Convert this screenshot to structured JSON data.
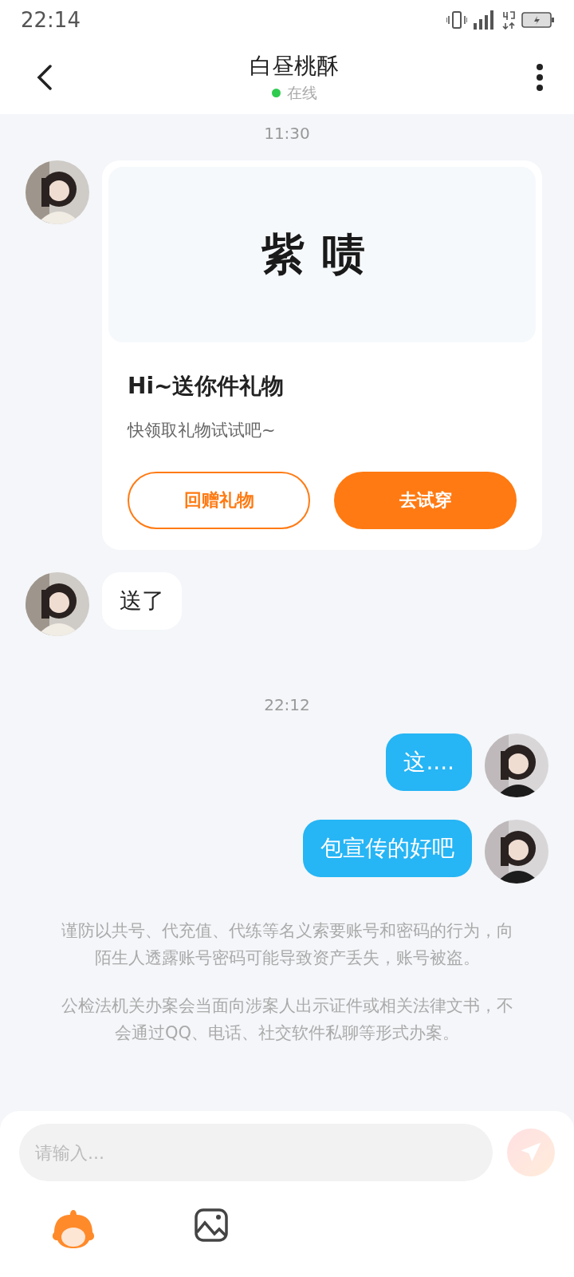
{
  "status_bar": {
    "time": "22:14"
  },
  "header": {
    "title": "白昼桃酥",
    "online": true,
    "status": "在线"
  },
  "messages": [
    {
      "kind": "time",
      "text": "11:30"
    },
    {
      "kind": "gift",
      "outgoing": false,
      "gift_name": "紫啧",
      "title": "Hi~送你件礼物",
      "subtitle": "快领取礼物试试吧~",
      "buttons": [
        {
          "label": "回赠礼物",
          "primary": false
        },
        {
          "label": "去试穿",
          "primary": true
        }
      ]
    },
    {
      "kind": "text",
      "outgoing": false,
      "text": "送了"
    },
    {
      "kind": "time",
      "text": "22:12"
    },
    {
      "kind": "text",
      "outgoing": true,
      "text": "这...."
    },
    {
      "kind": "text",
      "outgoing": true,
      "text": "包宣传的好吧"
    }
  ],
  "notices": [
    "谨防以共号、代充值、代练等名义索要账号和密码的行为，向陌生人透露账号密码可能导致资产丢失，账号被盗。",
    "公检法机关办案会当面向涉案人出示证件或相关法律文书，不会通过QQ、电话、社交软件私聊等形式办案。"
  ],
  "composer": {
    "placeholder": "请输入...",
    "send_disabled": true
  }
}
